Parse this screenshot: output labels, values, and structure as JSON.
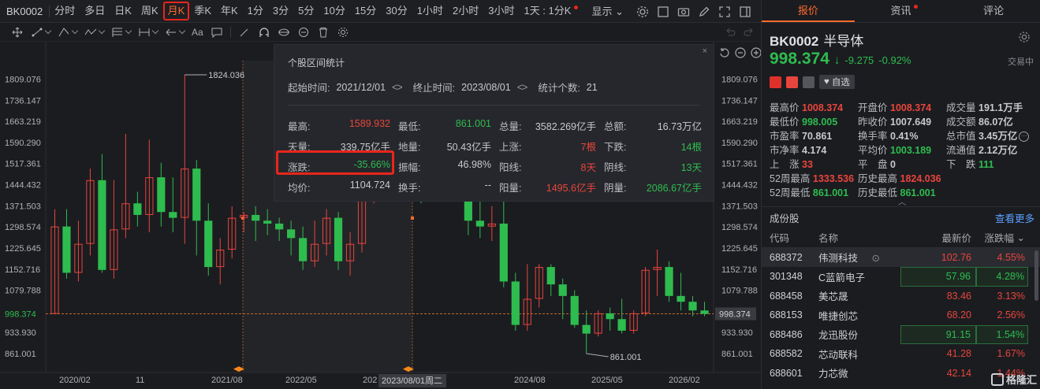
{
  "toolbar": {
    "code": "BK0002",
    "periods": [
      "分时",
      "多日",
      "日K",
      "周K",
      "月K",
      "季K",
      "年K",
      "1分",
      "3分",
      "5分",
      "10分",
      "15分",
      "30分",
      "1小时",
      "2小时",
      "3小时",
      "1天 : 1分K"
    ],
    "active_period": "月K",
    "display_label": "显示"
  },
  "drawbar": {
    "text_tool": "Aa"
  },
  "chart": {
    "y_ticks": [
      "1809.076",
      "1736.147",
      "1663.219",
      "1590.290",
      "1517.361",
      "1444.432",
      "1371.503",
      "1298.574",
      "1225.645",
      "1152.716",
      "1079.788",
      "998.374",
      "933.930",
      "861.001"
    ],
    "y_tick_values": [
      1809.076,
      1736.147,
      1663.219,
      1590.29,
      1517.361,
      1444.432,
      1371.503,
      1298.574,
      1225.645,
      1152.716,
      1079.788,
      998.374,
      933.93,
      861.001
    ],
    "x_ticks": [
      "2020/02",
      "11",
      "2021/08",
      "2022/05",
      "202",
      "2024/08",
      "2025/05",
      "2026/02"
    ],
    "crosshair_date": "2023/08/01周二",
    "high_label": "1824.036",
    "low_label": "861.001",
    "current_price": "998.374",
    "current_price_value": 998.374
  },
  "chart_data": {
    "type": "candlestick",
    "title": "",
    "y_range": [
      861.001,
      1824.036
    ],
    "candles": [
      {
        "open": 998,
        "close": 1300,
        "high": 1360,
        "low": 998
      },
      {
        "open": 1300,
        "close": 1140,
        "high": 1360,
        "low": 1120
      },
      {
        "open": 1140,
        "close": 1240,
        "high": 1320,
        "low": 1110
      },
      {
        "open": 1240,
        "close": 1460,
        "high": 1500,
        "low": 1200
      },
      {
        "open": 1460,
        "close": 1150,
        "high": 1550,
        "low": 1140
      },
      {
        "open": 1150,
        "close": 1290,
        "high": 1460,
        "low": 1120
      },
      {
        "open": 1290,
        "close": 1380,
        "high": 1620,
        "low": 1260
      },
      {
        "open": 1380,
        "close": 1340,
        "high": 1420,
        "low": 1300
      },
      {
        "open": 1340,
        "close": 1470,
        "high": 1600,
        "low": 1280
      },
      {
        "open": 1470,
        "close": 1350,
        "high": 1520,
        "low": 1300
      },
      {
        "open": 1350,
        "close": 1330,
        "high": 1470,
        "low": 1280
      },
      {
        "open": 1330,
        "close": 1500,
        "high": 1824,
        "low": 1240
      },
      {
        "open": 1500,
        "close": 1320,
        "high": 1530,
        "low": 1200
      },
      {
        "open": 1320,
        "close": 1160,
        "high": 1380,
        "low": 1130
      },
      {
        "open": 1160,
        "close": 1220,
        "high": 1260,
        "low": 1100
      },
      {
        "open": 1220,
        "close": 1330,
        "high": 1370,
        "low": 1190
      },
      {
        "open": 1330,
        "close": 1340,
        "high": 1350,
        "low": 1280
      },
      {
        "open": 1340,
        "close": 1320,
        "high": 1370,
        "low": 1250
      },
      {
        "open": 1320,
        "close": 1310,
        "high": 1360,
        "low": 1270
      },
      {
        "open": 1310,
        "close": 1290,
        "high": 1330,
        "low": 1250
      },
      {
        "open": 1290,
        "close": 1260,
        "high": 1320,
        "low": 1200
      },
      {
        "open": 1260,
        "close": 1180,
        "high": 1300,
        "low": 1150
      },
      {
        "open": 1180,
        "close": 1240,
        "high": 1320,
        "low": 1160
      },
      {
        "open": 1240,
        "close": 1330,
        "high": 1360,
        "low": 1200
      },
      {
        "open": 1330,
        "close": 1180,
        "high": 1350,
        "low": 1150
      },
      {
        "open": 1180,
        "close": 1240,
        "high": 1280,
        "low": 1130
      },
      {
        "open": 1240,
        "close": 1420,
        "high": 1430,
        "low": 1210
      },
      {
        "open": 1420,
        "close": 1730,
        "high": 1780,
        "low": 1380
      },
      {
        "open": 1730,
        "close": 1590,
        "high": 1800,
        "low": 1560
      },
      {
        "open": 1590,
        "close": 1600,
        "high": 1720,
        "low": 1480
      },
      {
        "open": 1600,
        "close": 1460,
        "high": 1630,
        "low": 1400
      },
      {
        "open": 1460,
        "close": 1430,
        "high": 1560,
        "low": 1380
      },
      {
        "open": 1430,
        "close": 1450,
        "high": 1470,
        "low": 1400
      },
      {
        "open": 1450,
        "close": 1520,
        "high": 1640,
        "low": 1430
      },
      {
        "open": 1520,
        "close": 1480,
        "high": 1560,
        "low": 1440
      },
      {
        "open": 1480,
        "close": 1320,
        "high": 1490,
        "low": 1270
      },
      {
        "open": 1320,
        "close": 1300,
        "high": 1420,
        "low": 1260
      },
      {
        "open": 1300,
        "close": 1310,
        "high": 1370,
        "low": 1250
      },
      {
        "open": 1310,
        "close": 1110,
        "high": 1420,
        "low": 1090
      },
      {
        "open": 1110,
        "close": 960,
        "high": 1140,
        "low": 940
      },
      {
        "open": 960,
        "close": 1050,
        "high": 1170,
        "low": 940
      },
      {
        "open": 1050,
        "close": 1160,
        "high": 1170,
        "low": 1020
      },
      {
        "open": 1160,
        "close": 1100,
        "high": 1170,
        "low": 1060
      },
      {
        "open": 1100,
        "close": 1060,
        "high": 1120,
        "low": 980
      },
      {
        "open": 1060,
        "close": 960,
        "high": 1080,
        "low": 950
      },
      {
        "open": 960,
        "close": 930,
        "high": 1010,
        "low": 861
      },
      {
        "open": 930,
        "close": 1000,
        "high": 1010,
        "low": 920
      },
      {
        "open": 1000,
        "close": 980,
        "high": 1020,
        "low": 940
      },
      {
        "open": 980,
        "close": 940,
        "high": 1050,
        "low": 930
      },
      {
        "open": 940,
        "close": 1000,
        "high": 1010,
        "low": 930
      },
      {
        "open": 1000,
        "close": 1150,
        "high": 1160,
        "low": 990
      },
      {
        "open": 1150,
        "close": 1160,
        "high": 1220,
        "low": 1060
      },
      {
        "open": 1160,
        "close": 1060,
        "high": 1180,
        "low": 1040
      },
      {
        "open": 1060,
        "close": 1040,
        "high": 1140,
        "low": 1010
      },
      {
        "open": 1040,
        "close": 1010,
        "high": 1060,
        "low": 990
      },
      {
        "open": 1010,
        "close": 998,
        "high": 1040,
        "low": 990
      }
    ]
  },
  "stats": {
    "title": "个股区间统计",
    "start_label": "起始时间:",
    "start": "2021/12/01",
    "end_label": "终止时间:",
    "end": "2023/08/01",
    "count_label": "统计个数:",
    "count": "21",
    "rows": [
      [
        {
          "k": "最高:",
          "v": "1589.932",
          "c": "red"
        },
        {
          "k": "最低:",
          "v": "861.001",
          "c": "green"
        },
        {
          "k": "总量:",
          "v": "3582.269亿手",
          "c": "white"
        },
        {
          "k": "总额:",
          "v": "16.73万亿",
          "c": "white"
        }
      ],
      [
        {
          "k": "天量:",
          "v": "339.75亿手",
          "c": "white"
        },
        {
          "k": "地量:",
          "v": "50.43亿手",
          "c": "white"
        },
        {
          "k": "上涨:",
          "v": "7根",
          "c": "red"
        },
        {
          "k": "下跌:",
          "v": "14根",
          "c": "green"
        }
      ],
      [
        {
          "k": "涨跌:",
          "v": "-35.66%",
          "c": "green"
        },
        {
          "k": "振幅:",
          "v": "46.98%",
          "c": "white"
        },
        {
          "k": "阳线:",
          "v": "8天",
          "c": "red"
        },
        {
          "k": "阴线:",
          "v": "13天",
          "c": "green"
        }
      ],
      [
        {
          "k": "均价:",
          "v": "1104.724",
          "c": "white"
        },
        {
          "k": "换手:",
          "v": "--",
          "c": "white"
        },
        {
          "k": "阳量:",
          "v": "1495.6亿手",
          "c": "red"
        },
        {
          "k": "阴量:",
          "v": "2086.67亿手",
          "c": "green"
        }
      ]
    ]
  },
  "panel": {
    "tabs": [
      "报价",
      "资讯",
      "评论"
    ],
    "active_tab": "报价",
    "code": "BK0002",
    "name": "半导体",
    "price": "998.374",
    "change": "-9.275",
    "change_pct": "-0.92%",
    "trade_status": "交易中",
    "watch_label": "自选",
    "quote": [
      [
        {
          "k": "最高价",
          "v": "1008.374",
          "c": "red"
        },
        {
          "k": "开盘价",
          "v": "1008.374",
          "c": "red"
        },
        {
          "k": "成交量",
          "v": "191.1万手",
          "c": "white"
        }
      ],
      [
        {
          "k": "最低价",
          "v": "998.005",
          "c": "green"
        },
        {
          "k": "昨收价",
          "v": "1007.649",
          "c": "white"
        },
        {
          "k": "成交额",
          "v": "86.07亿",
          "c": "white"
        }
      ],
      [
        {
          "k": "市盈率",
          "v": "70.861",
          "c": "white"
        },
        {
          "k": "换手率",
          "v": "0.41%",
          "c": "white"
        },
        {
          "k": "总市值",
          "v": "3.45万亿",
          "c": "white"
        }
      ],
      [
        {
          "k": "市净率",
          "v": "4.174",
          "c": "white"
        },
        {
          "k": "平均价",
          "v": "1003.189",
          "c": "green"
        },
        {
          "k": "流通值",
          "v": "2.12万亿",
          "c": "white"
        }
      ],
      [
        {
          "k": "上　涨",
          "v": "33",
          "c": "red"
        },
        {
          "k": "平　盘",
          "v": "0",
          "c": "white"
        },
        {
          "k": "下　跌",
          "v": "111",
          "c": "green"
        }
      ],
      [
        {
          "k": "52周最高",
          "v": "1333.536",
          "c": "red"
        },
        {
          "k": "历史最高",
          "v": "1824.036",
          "c": "red"
        },
        {
          "k": "",
          "v": "",
          "c": "white"
        }
      ],
      [
        {
          "k": "52周最低",
          "v": "861.001",
          "c": "green"
        },
        {
          "k": "历史最低",
          "v": "861.001",
          "c": "green"
        },
        {
          "k": "",
          "v": "",
          "c": "white"
        }
      ]
    ],
    "constituents_title": "成份股",
    "see_more": "查看更多",
    "table_headers": [
      "代码",
      "名称",
      "最新价",
      "涨跌幅"
    ],
    "rows": [
      {
        "code": "688372",
        "name": "伟测科技",
        "price": "102.76",
        "pct": "4.55%",
        "c": "red"
      },
      {
        "code": "301348",
        "name": "C蓝箭电子",
        "price": "57.96",
        "pct": "4.28%",
        "c": "green"
      },
      {
        "code": "688458",
        "name": "美芯晟",
        "price": "83.46",
        "pct": "3.13%",
        "c": "red"
      },
      {
        "code": "688153",
        "name": "唯捷创芯",
        "price": "68.20",
        "pct": "2.56%",
        "c": "red"
      },
      {
        "code": "688486",
        "name": "龙迅股份",
        "price": "91.15",
        "pct": "1.54%",
        "c": "green"
      },
      {
        "code": "688582",
        "name": "芯动联科",
        "price": "41.28",
        "pct": "1.67%",
        "c": "red"
      },
      {
        "code": "688601",
        "name": "力芯微",
        "price": "42.14",
        "pct": "1.44%",
        "c": "red"
      }
    ],
    "logo_text": "格隆汇"
  },
  "colors": {
    "up": "#e8453c",
    "down": "#2ebc4f",
    "accent": "#ff6a2b",
    "bg": "#1b1c20"
  }
}
